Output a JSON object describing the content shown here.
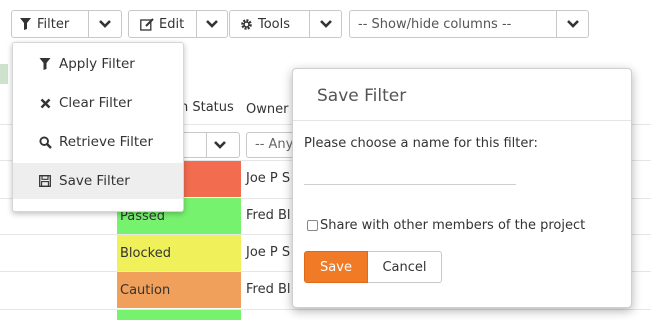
{
  "toolbar": {
    "filter_label": "Filter",
    "edit_label": "Edit",
    "tools_label": "Tools",
    "columns_select_value": "-- Show/hide columns --"
  },
  "filter_menu": {
    "items": [
      {
        "label": "Apply Filter",
        "icon": "filter-icon"
      },
      {
        "label": "Clear Filter",
        "icon": "x-icon"
      },
      {
        "label": "Retrieve Filter",
        "icon": "search-icon"
      },
      {
        "label": "Save Filter",
        "icon": "floppy-disk-icon"
      }
    ],
    "active_item": "Save Filter"
  },
  "table": {
    "header": {
      "status_partial": "n Status",
      "owner": "Owner"
    },
    "owner_filter_placeholder_partial": "-- Any",
    "rows": [
      {
        "status": "",
        "status_color": "#f26c4f",
        "owner_partial": "Joe P S"
      },
      {
        "status": "Passed",
        "status_color": "#77f26f",
        "owner_partial": "Fred Bl"
      },
      {
        "status": "Blocked",
        "status_color": "#f0f05a",
        "owner_partial": "Joe P S"
      },
      {
        "status": "Caution",
        "status_color": "#f0a05a",
        "owner_partial": "Fred Bl"
      },
      {
        "status": "",
        "status_color": "#77f26f",
        "owner_partial": ""
      }
    ]
  },
  "save_filter_dialog": {
    "title": "Save Filter",
    "prompt": "Please choose a name for this filter:",
    "name_value": "",
    "share_label": "Share with other members of the project",
    "share_checked": false,
    "save_label": "Save",
    "cancel_label": "Cancel"
  },
  "colors": {
    "accent": "#f07a26",
    "menu_active_bg": "#eeeeee"
  }
}
